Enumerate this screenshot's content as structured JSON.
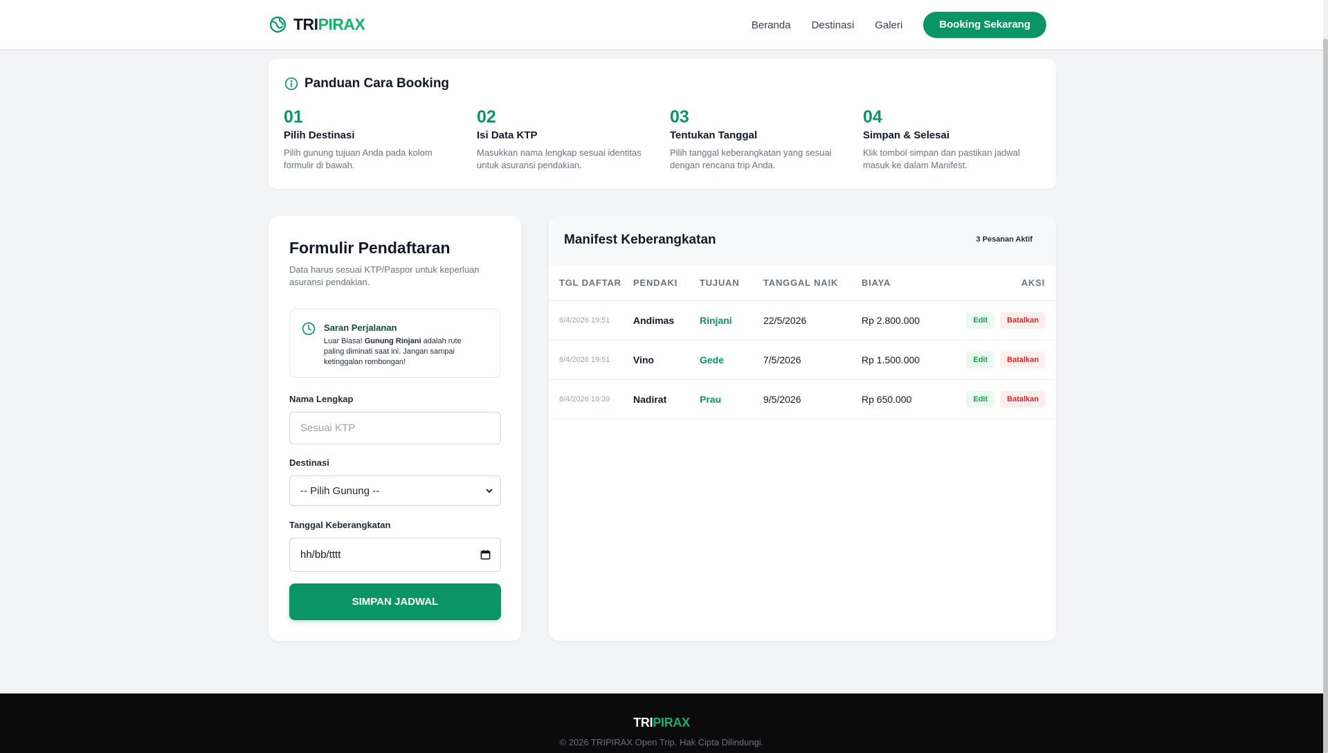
{
  "brand": {
    "part1": "TRI",
    "part2": "PIRAX",
    "icon": "globe-leaf-icon",
    "accent": "#0b9466"
  },
  "nav": {
    "items": [
      "Beranda",
      "Destinasi",
      "Galeri"
    ],
    "cta": "Booking Sekarang"
  },
  "guide": {
    "title": "Panduan Cara Booking",
    "steps": [
      {
        "num": "01",
        "title": "Pilih Destinasi",
        "desc": "Pilih gunung tujuan Anda pada kolom formulir di bawah."
      },
      {
        "num": "02",
        "title": "Isi Data KTP",
        "desc": "Masukkan nama lengkap sesuai identitas untuk asuransi pendakian."
      },
      {
        "num": "03",
        "title": "Tentukan Tanggal",
        "desc": "Pilih tanggal keberangkatan yang sesuai dengan rencana trip Anda."
      },
      {
        "num": "04",
        "title": "Simpan & Selesai",
        "desc": "Klik tombol simpan dan pastikan jadwal masuk ke dalam Manifest."
      }
    ]
  },
  "form": {
    "title": "Formulir Pendaftaran",
    "subtitle": "Data harus sesuai KTP/Paspor untuk keperluan asuransi pendakian.",
    "tip": {
      "title": "Saran Perjalanan",
      "pre": "Luar Biasa! ",
      "bold": "Gunung Rinjani",
      "post": " adalah rute paling diminati saat ini. Jangan sampai ketinggalan rombongan!"
    },
    "name_label": "Nama Lengkap",
    "name_placeholder": "Sesuai KTP",
    "dest_label": "Destinasi",
    "dest_value": "-- Pilih Gunung --",
    "date_label": "Tanggal Keberangkatan",
    "date_value": "hh/bb/tttt",
    "submit": "SIMPAN JADWAL"
  },
  "manifest": {
    "title": "Manifest Keberangkatan",
    "badge": "3 Pesanan Aktif",
    "columns": [
      "TGL DAFTAR",
      "PENDAKI",
      "TUJUAN",
      "TANGGAL NAIK",
      "BIAYA",
      "AKSI"
    ],
    "rows": [
      {
        "registered": "6/4/2026 19:51",
        "hiker": "Andimas",
        "destination": "Rinjani",
        "date": "22/5/2026",
        "cost": "Rp 2.800.000",
        "edit": "Edit",
        "cancel": "Batalkan"
      },
      {
        "registered": "6/4/2026 19:51",
        "hiker": "Vino",
        "destination": "Gede",
        "date": "7/5/2026",
        "cost": "Rp 1.500.000",
        "edit": "Edit",
        "cancel": "Batalkan"
      },
      {
        "registered": "6/4/2026 19:39",
        "hiker": "Nadirat",
        "destination": "Prau",
        "date": "9/5/2026",
        "cost": "Rp 650.000",
        "edit": "Edit",
        "cancel": "Batalkan"
      }
    ]
  },
  "footer": {
    "part1": "TRI",
    "part2": "PIRAX",
    "copyright": "© 2026 TRIPIRAX Open Trip. Hak Cipta Dilindungi."
  }
}
